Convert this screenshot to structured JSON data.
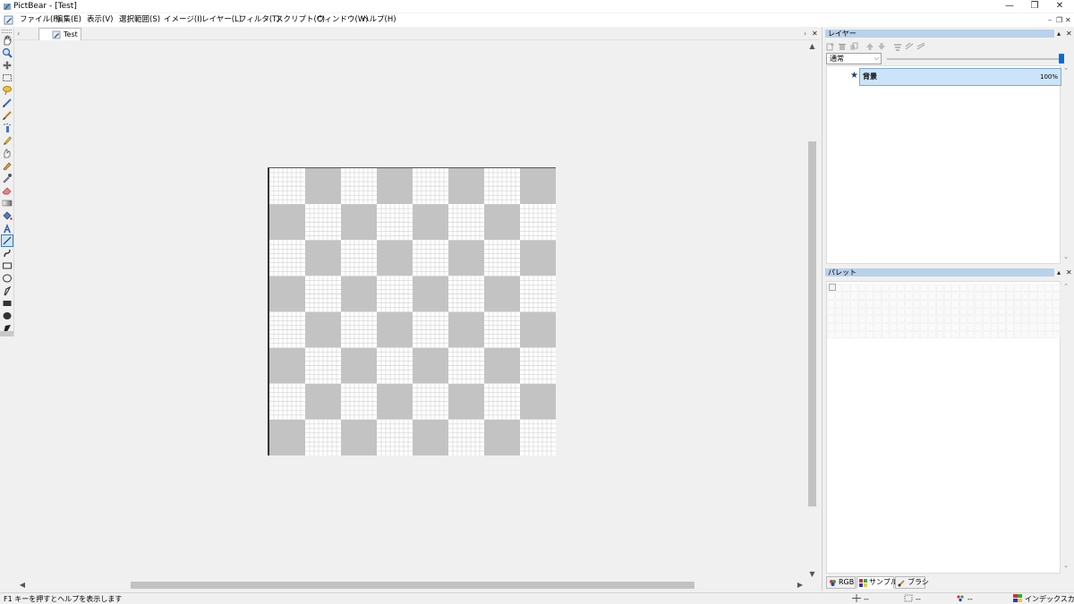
{
  "window": {
    "title": "PictBear - [Test]",
    "controls": {
      "minimize": "—",
      "restore": "❐",
      "close": "✕"
    }
  },
  "menu": {
    "items": [
      "ファイル(F)",
      "編集(E)",
      "表示(V)",
      "選択範囲(S)",
      "イメージ(I)",
      "レイヤー(L)",
      "フィルタ(T)",
      "スクリプト(C)",
      "ウィンドウ(W)",
      "ヘルプ(H)"
    ],
    "mdi_controls": {
      "minimize": "–",
      "restore": "❐",
      "close": "✕"
    }
  },
  "tools": [
    "hand-icon",
    "zoom-icon",
    "move-icon",
    "rect-select-icon",
    "lasso-icon",
    "line-pen-icon",
    "brush-icon",
    "spray-icon",
    "pencil-icon",
    "smudge-icon",
    "dodge-icon",
    "eyedropper-icon",
    "eraser-icon",
    "gradient-icon",
    "fill-bucket-icon",
    "text-icon",
    "line-tool-icon",
    "curve-icon",
    "rectangle-icon",
    "ellipse-icon",
    "freeform-icon",
    "filled-rect-icon",
    "filled-ellipse-icon",
    "filled-freeform-icon"
  ],
  "selected_tool": "line-tool-icon",
  "document": {
    "tab_label": "Test",
    "nav_prev": "‹",
    "nav_next": "›",
    "close": "✕",
    "checker": {
      "cols": 8,
      "rows": 8,
      "dark_color": "#c3c3c3",
      "light_color": "#ffffff",
      "grid_color": "#c8c8c8",
      "first_cell_dark": false
    }
  },
  "layer_panel": {
    "title": "レイヤー",
    "blend_mode": "通常",
    "opacity_value": 100,
    "layers": [
      {
        "name": "背景",
        "opacity": "100%",
        "marker": "★"
      }
    ]
  },
  "palette_panel": {
    "title": "パレット",
    "tabs": [
      {
        "label": "RGB",
        "icon": "rgb-icon",
        "active": false
      },
      {
        "label": "サンプル",
        "icon": "sample-icon",
        "active": true
      },
      {
        "label": "ブラシ",
        "icon": "brush-tab-icon",
        "active": false
      }
    ]
  },
  "status": {
    "help": "F1 キーを押すとヘルプを表示します",
    "cursor_pos": "--",
    "selection_size": "--",
    "color_value": "--",
    "color_mode": "インデックスカラー"
  },
  "colors": {
    "accent": "#0a6ad6",
    "pane_header": "#b9d1ea",
    "selected_layer": "#cce4f7",
    "checker_dark": "#c3c3c3"
  }
}
